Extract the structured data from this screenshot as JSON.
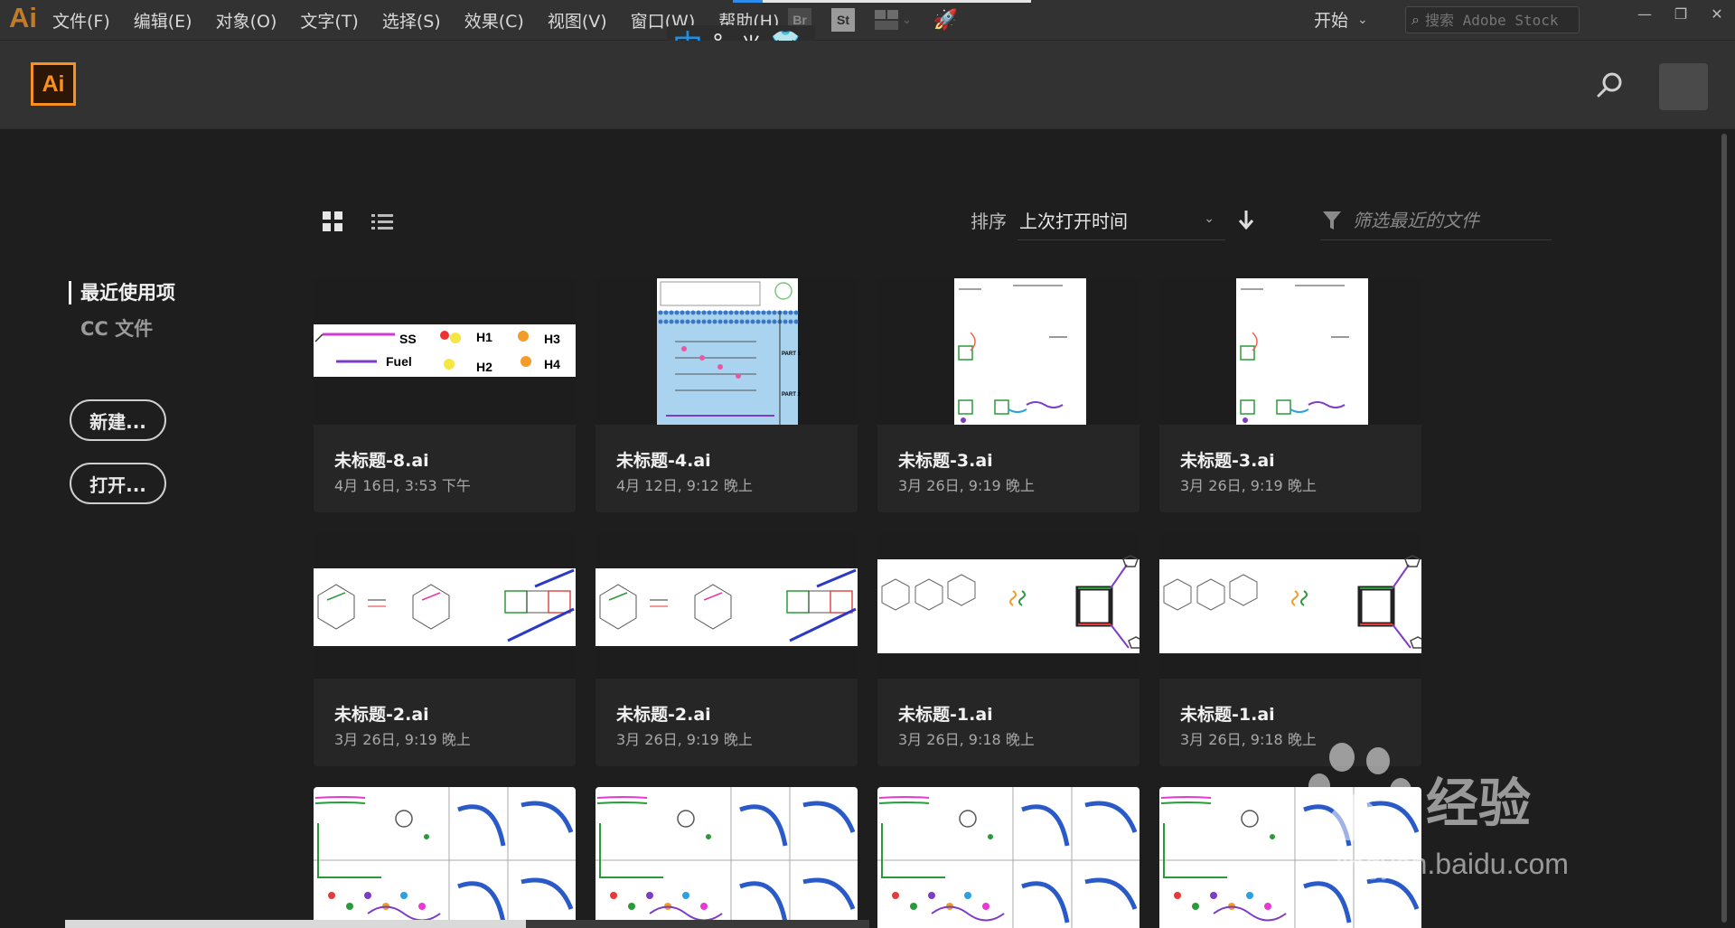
{
  "menubar": {
    "logo": "Ai",
    "items": [
      "文件(F)",
      "编辑(E)",
      "对象(O)",
      "文字(T)",
      "选择(S)",
      "效果(C)",
      "视图(V)",
      "窗口(W)",
      "帮助(H)"
    ],
    "tools": {
      "bridge": "Br",
      "stock": "St"
    },
    "workspace_label": "开始",
    "stock_search_placeholder": "搜索 Adobe Stock",
    "download_progress": 0.1,
    "window_buttons": {
      "minimize": "—",
      "restore": "❐",
      "close": "✕"
    }
  },
  "ime": {
    "mode": "中",
    "punct": "°,",
    "width": "半",
    "skin_icon": "shirt-icon"
  },
  "header": {
    "logo": "Ai"
  },
  "sidebar": {
    "nav": [
      {
        "label": "最近使用项",
        "active": true
      },
      {
        "label": "CC 文件",
        "active": false
      }
    ],
    "new_button": "新建...",
    "open_button": "打开..."
  },
  "toolbar": {
    "sort_label": "排序",
    "sort_value": "上次打开时间",
    "filter_placeholder": "筛选最近的文件"
  },
  "files": [
    {
      "name": "未标题-8.ai",
      "date": "4月 16日, 3:53 下午",
      "thumb": "strands"
    },
    {
      "name": "未标题-4.ai",
      "date": "4月 12日, 9:12 晚上",
      "thumb": "membrane"
    },
    {
      "name": "未标题-3.ai",
      "date": "3月 26日, 9:19 晚上",
      "thumb": "portrait"
    },
    {
      "name": "未标题-3.ai",
      "date": "3月 26日, 9:19 晚上",
      "thumb": "portrait"
    },
    {
      "name": "未标题-2.ai",
      "date": "3月 26日, 9:19 晚上",
      "thumb": "prism"
    },
    {
      "name": "未标题-2.ai",
      "date": "3月 26日, 9:19 晚上",
      "thumb": "prism"
    },
    {
      "name": "未标题-1.ai",
      "date": "3月 26日, 9:18 晚上",
      "thumb": "box"
    },
    {
      "name": "未标题-1.ai",
      "date": "3月 26日, 9:18 晚上",
      "thumb": "box"
    },
    {
      "name": "",
      "date": "",
      "thumb": "panels"
    },
    {
      "name": "",
      "date": "",
      "thumb": "panels"
    },
    {
      "name": "",
      "date": "",
      "thumb": "panels"
    },
    {
      "name": "",
      "date": "",
      "thumb": "panels"
    }
  ],
  "thumb_labels": {
    "strands": [
      "SS",
      "H1",
      "H3",
      "Fuel",
      "H2",
      "H4"
    ],
    "membrane": [
      "PART 1",
      "PART 2"
    ]
  },
  "watermark": {
    "brand": "经验",
    "url": "jingyan.baidu.com",
    "logo_text": "Bai du"
  },
  "colors": {
    "accent": "#f7901e",
    "ime_blue": "#1e8fe3",
    "progress_blue": "#2d8ceb"
  }
}
